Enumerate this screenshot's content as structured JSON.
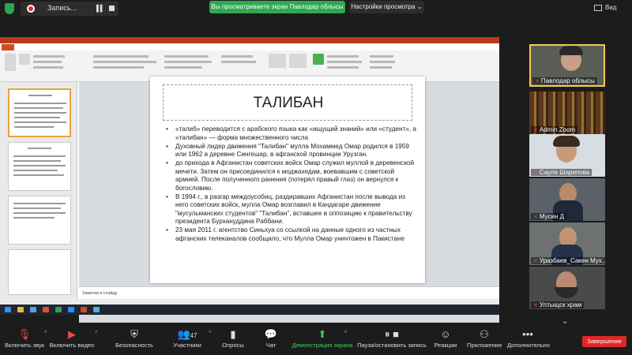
{
  "top_bar": {
    "recording_label": "Запись...",
    "share_banner": "Вы просматриваете экран Павлодар облысы",
    "view_options": "Настройки просмотра",
    "view_button": "Вид"
  },
  "slide": {
    "title": "ТАЛИБАН",
    "bullets": [
      "«талиб» переводится с арабского языка как «ищущий знаний» или «студент», а «талибан» — форма множественного числа",
      "Духовный лидер движения \"Талибан\" мулла Мохаммед Омар родился в 1959 или 1962 в деревне Сингешар, в афганской провинции Урузган.",
      "до прихода в Афганистан советских войск Омар служил муллой в деревенской мечети. Затем он присоединился к моджахедам, воевавшим с советской армией. После полученного ранения (потерял правый глаз) он вернулся к богословию.",
      "В 1994 г., в разгар междоусобиц, раздиравших Афганистан после вывода из него советских войск, мулла Омар возглавил в Кандагаре движение \"мусульманских студентов\" \"Талибан\", вставшее в оппозицию к правительству президента Бурхануддина Раббани.",
      "23 мая 2011 г. агентство Синьхуа со ссылкой на данные одного из частных афганских телеканалов сообщило, что Мулла Омар уничтожен в Пакистане"
    ],
    "notes_placeholder": "Заметки к слайду"
  },
  "participants": [
    {
      "name": "Павлодар облысы",
      "active": true
    },
    {
      "name": "Admin Zoom",
      "active": false
    },
    {
      "name": "Сауле Шарипова",
      "active": false
    },
    {
      "name": "Мусин Д",
      "active": false
    },
    {
      "name": "Уразбаев_Сакен Мух...",
      "active": false
    },
    {
      "name": "Ултыщск храм",
      "active": false
    }
  ],
  "toolbar": {
    "mute": "Включить звук",
    "video": "Включить видео",
    "security": "Безопасность",
    "participants": "Участники",
    "participants_count": "47",
    "polls": "Опросы",
    "chat": "Чат",
    "share": "Демонстрация экрана",
    "pause_record": "Пауза/остановить запись",
    "reactions": "Реакции",
    "apps": "Приложения",
    "more": "Дополнительно",
    "end": "Завершение"
  },
  "colors": {
    "share_green": "#2fa84f",
    "end_red": "#e02828",
    "active_speaker": "#f6c84b",
    "ppt_orange": "#d24726"
  }
}
